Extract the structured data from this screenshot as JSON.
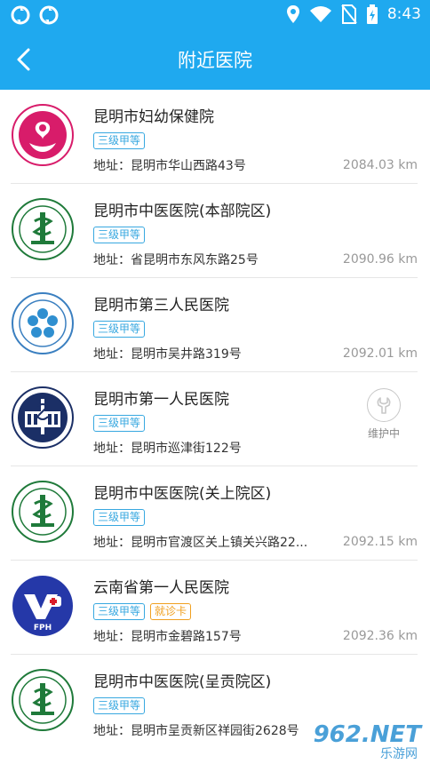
{
  "status_bar": {
    "time": "8:43",
    "icons": [
      "sync-icon",
      "sync-icon",
      "location-icon",
      "wifi-icon",
      "no-sim-icon",
      "battery-charging-icon"
    ]
  },
  "header": {
    "title": "附近医院",
    "back_icon": "chevron-left-icon",
    "background": "#1fa9ef"
  },
  "hospitals": [
    {
      "name": "昆明市妇幼保健院",
      "tags": [
        "三级甲等"
      ],
      "address": "地址：昆明市华山西路43号",
      "distance": "2084.03 km",
      "logo": "maternal-logo"
    },
    {
      "name": "昆明市中医医院(本部院区)",
      "tags": [
        "三级甲等"
      ],
      "address": "地址：省昆明市东风东路25号",
      "distance": "2090.96 km",
      "logo": "tcm-logo"
    },
    {
      "name": "昆明市第三人民医院",
      "tags": [
        "三级甲等"
      ],
      "address": "地址：昆明市吴井路319号",
      "distance": "2092.01 km",
      "logo": "third-people-logo"
    },
    {
      "name": "昆明市第一人民医院",
      "tags": [
        "三级甲等"
      ],
      "address": "地址：昆明市巡津街122号",
      "distance": "",
      "maintenance": "维护中",
      "logo": "first-people-logo"
    },
    {
      "name": "昆明市中医医院(关上院区)",
      "tags": [
        "三级甲等"
      ],
      "address": "地址：昆明市官渡区关上镇关兴路22...",
      "distance": "2092.15 km",
      "logo": "tcm-logo"
    },
    {
      "name": "云南省第一人民医院",
      "tags": [
        "三级甲等",
        "就诊卡"
      ],
      "address": "地址：昆明市金碧路157号",
      "distance": "2092.36 km",
      "logo": "fph-logo",
      "logo_text": "FPH"
    },
    {
      "name": "昆明市中医医院(呈贡院区)",
      "tags": [
        "三级甲等"
      ],
      "address": "地址：昆明市呈贡新区祥园街2628号",
      "distance": "",
      "logo": "tcm-logo"
    }
  ],
  "watermark": {
    "main": "962.NET",
    "sub": "乐游网"
  },
  "colors": {
    "tag_blue": "#38a8e0",
    "tag_orange": "#f0a020",
    "maternal_pink": "#d81c6a",
    "tcm_green": "#1f7a3a",
    "navy": "#1b2f66",
    "fph_blue": "#2538a8"
  }
}
